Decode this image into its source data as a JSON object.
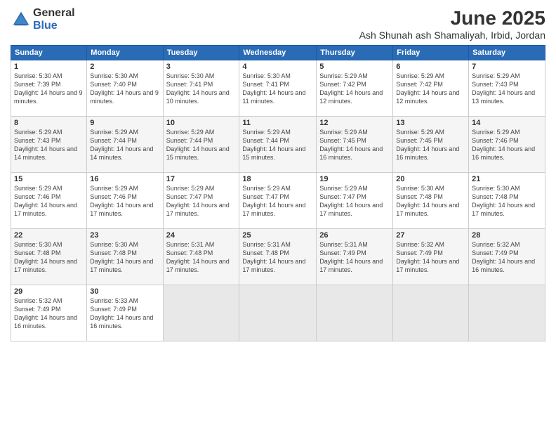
{
  "header": {
    "logo_general": "General",
    "logo_blue": "Blue",
    "title": "June 2025",
    "subtitle": "Ash Shunah ash Shamaliyah, Irbid, Jordan"
  },
  "days_of_week": [
    "Sunday",
    "Monday",
    "Tuesday",
    "Wednesday",
    "Thursday",
    "Friday",
    "Saturday"
  ],
  "weeks": [
    [
      {
        "day": "1",
        "sunrise": "Sunrise: 5:30 AM",
        "sunset": "Sunset: 7:39 PM",
        "daylight": "Daylight: 14 hours and 9 minutes."
      },
      {
        "day": "2",
        "sunrise": "Sunrise: 5:30 AM",
        "sunset": "Sunset: 7:40 PM",
        "daylight": "Daylight: 14 hours and 9 minutes."
      },
      {
        "day": "3",
        "sunrise": "Sunrise: 5:30 AM",
        "sunset": "Sunset: 7:41 PM",
        "daylight": "Daylight: 14 hours and 10 minutes."
      },
      {
        "day": "4",
        "sunrise": "Sunrise: 5:30 AM",
        "sunset": "Sunset: 7:41 PM",
        "daylight": "Daylight: 14 hours and 11 minutes."
      },
      {
        "day": "5",
        "sunrise": "Sunrise: 5:29 AM",
        "sunset": "Sunset: 7:42 PM",
        "daylight": "Daylight: 14 hours and 12 minutes."
      },
      {
        "day": "6",
        "sunrise": "Sunrise: 5:29 AM",
        "sunset": "Sunset: 7:42 PM",
        "daylight": "Daylight: 14 hours and 12 minutes."
      },
      {
        "day": "7",
        "sunrise": "Sunrise: 5:29 AM",
        "sunset": "Sunset: 7:43 PM",
        "daylight": "Daylight: 14 hours and 13 minutes."
      }
    ],
    [
      {
        "day": "8",
        "sunrise": "Sunrise: 5:29 AM",
        "sunset": "Sunset: 7:43 PM",
        "daylight": "Daylight: 14 hours and 14 minutes."
      },
      {
        "day": "9",
        "sunrise": "Sunrise: 5:29 AM",
        "sunset": "Sunset: 7:44 PM",
        "daylight": "Daylight: 14 hours and 14 minutes."
      },
      {
        "day": "10",
        "sunrise": "Sunrise: 5:29 AM",
        "sunset": "Sunset: 7:44 PM",
        "daylight": "Daylight: 14 hours and 15 minutes."
      },
      {
        "day": "11",
        "sunrise": "Sunrise: 5:29 AM",
        "sunset": "Sunset: 7:44 PM",
        "daylight": "Daylight: 14 hours and 15 minutes."
      },
      {
        "day": "12",
        "sunrise": "Sunrise: 5:29 AM",
        "sunset": "Sunset: 7:45 PM",
        "daylight": "Daylight: 14 hours and 16 minutes."
      },
      {
        "day": "13",
        "sunrise": "Sunrise: 5:29 AM",
        "sunset": "Sunset: 7:45 PM",
        "daylight": "Daylight: 14 hours and 16 minutes."
      },
      {
        "day": "14",
        "sunrise": "Sunrise: 5:29 AM",
        "sunset": "Sunset: 7:46 PM",
        "daylight": "Daylight: 14 hours and 16 minutes."
      }
    ],
    [
      {
        "day": "15",
        "sunrise": "Sunrise: 5:29 AM",
        "sunset": "Sunset: 7:46 PM",
        "daylight": "Daylight: 14 hours and 17 minutes."
      },
      {
        "day": "16",
        "sunrise": "Sunrise: 5:29 AM",
        "sunset": "Sunset: 7:46 PM",
        "daylight": "Daylight: 14 hours and 17 minutes."
      },
      {
        "day": "17",
        "sunrise": "Sunrise: 5:29 AM",
        "sunset": "Sunset: 7:47 PM",
        "daylight": "Daylight: 14 hours and 17 minutes."
      },
      {
        "day": "18",
        "sunrise": "Sunrise: 5:29 AM",
        "sunset": "Sunset: 7:47 PM",
        "daylight": "Daylight: 14 hours and 17 minutes."
      },
      {
        "day": "19",
        "sunrise": "Sunrise: 5:29 AM",
        "sunset": "Sunset: 7:47 PM",
        "daylight": "Daylight: 14 hours and 17 minutes."
      },
      {
        "day": "20",
        "sunrise": "Sunrise: 5:30 AM",
        "sunset": "Sunset: 7:48 PM",
        "daylight": "Daylight: 14 hours and 17 minutes."
      },
      {
        "day": "21",
        "sunrise": "Sunrise: 5:30 AM",
        "sunset": "Sunset: 7:48 PM",
        "daylight": "Daylight: 14 hours and 17 minutes."
      }
    ],
    [
      {
        "day": "22",
        "sunrise": "Sunrise: 5:30 AM",
        "sunset": "Sunset: 7:48 PM",
        "daylight": "Daylight: 14 hours and 17 minutes."
      },
      {
        "day": "23",
        "sunrise": "Sunrise: 5:30 AM",
        "sunset": "Sunset: 7:48 PM",
        "daylight": "Daylight: 14 hours and 17 minutes."
      },
      {
        "day": "24",
        "sunrise": "Sunrise: 5:31 AM",
        "sunset": "Sunset: 7:48 PM",
        "daylight": "Daylight: 14 hours and 17 minutes."
      },
      {
        "day": "25",
        "sunrise": "Sunrise: 5:31 AM",
        "sunset": "Sunset: 7:48 PM",
        "daylight": "Daylight: 14 hours and 17 minutes."
      },
      {
        "day": "26",
        "sunrise": "Sunrise: 5:31 AM",
        "sunset": "Sunset: 7:49 PM",
        "daylight": "Daylight: 14 hours and 17 minutes."
      },
      {
        "day": "27",
        "sunrise": "Sunrise: 5:32 AM",
        "sunset": "Sunset: 7:49 PM",
        "daylight": "Daylight: 14 hours and 17 minutes."
      },
      {
        "day": "28",
        "sunrise": "Sunrise: 5:32 AM",
        "sunset": "Sunset: 7:49 PM",
        "daylight": "Daylight: 14 hours and 16 minutes."
      }
    ],
    [
      {
        "day": "29",
        "sunrise": "Sunrise: 5:32 AM",
        "sunset": "Sunset: 7:49 PM",
        "daylight": "Daylight: 14 hours and 16 minutes."
      },
      {
        "day": "30",
        "sunrise": "Sunrise: 5:33 AM",
        "sunset": "Sunset: 7:49 PM",
        "daylight": "Daylight: 14 hours and 16 minutes."
      },
      null,
      null,
      null,
      null,
      null
    ]
  ]
}
